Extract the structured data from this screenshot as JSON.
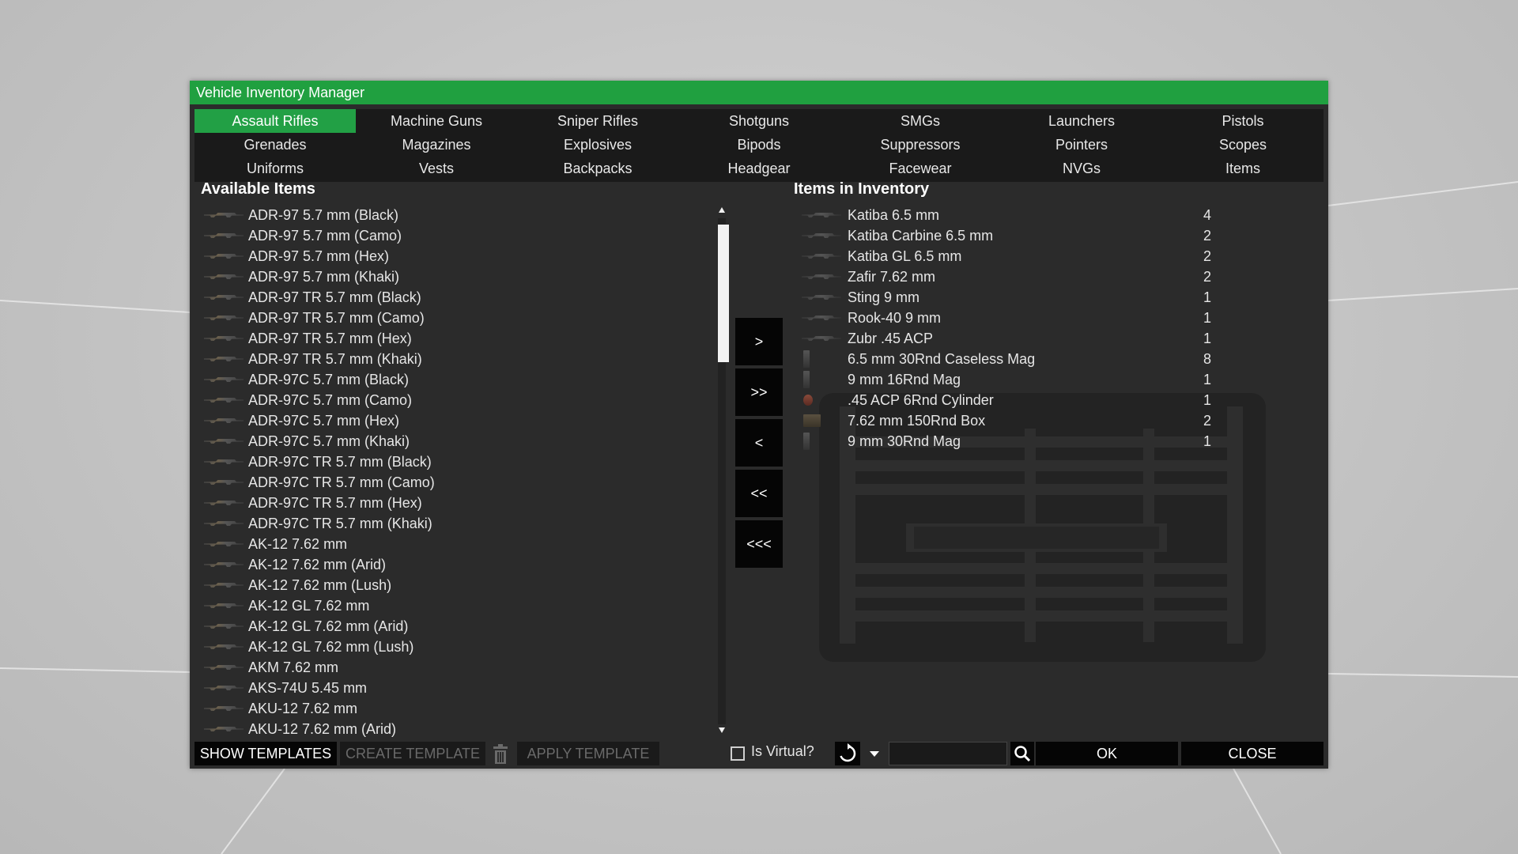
{
  "window": {
    "title": "Vehicle Inventory Manager"
  },
  "tabs": [
    {
      "label": "Assault Rifles",
      "active": true
    },
    {
      "label": "Machine Guns"
    },
    {
      "label": "Sniper Rifles"
    },
    {
      "label": "Shotguns"
    },
    {
      "label": "SMGs"
    },
    {
      "label": "Launchers"
    },
    {
      "label": "Pistols"
    },
    {
      "label": "Grenades"
    },
    {
      "label": "Magazines"
    },
    {
      "label": "Explosives"
    },
    {
      "label": "Bipods"
    },
    {
      "label": "Suppressors"
    },
    {
      "label": "Pointers"
    },
    {
      "label": "Scopes"
    },
    {
      "label": "Uniforms"
    },
    {
      "label": "Vests"
    },
    {
      "label": "Backpacks"
    },
    {
      "label": "Headgear"
    },
    {
      "label": "Facewear"
    },
    {
      "label": "NVGs"
    },
    {
      "label": "Items"
    }
  ],
  "available": {
    "title": "Available Items",
    "items": [
      {
        "label": "ADR-97 5.7 mm (Black)",
        "dlc": ""
      },
      {
        "label": "ADR-97 5.7 mm (Camo)",
        "dlc": ""
      },
      {
        "label": "ADR-97 5.7 mm (Hex)",
        "dlc": ""
      },
      {
        "label": "ADR-97 5.7 mm (Khaki)",
        "dlc": ""
      },
      {
        "label": "ADR-97 TR 5.7 mm (Black)",
        "dlc": ""
      },
      {
        "label": "ADR-97 TR 5.7 mm (Camo)",
        "dlc": ""
      },
      {
        "label": "ADR-97 TR 5.7 mm (Hex)",
        "dlc": ""
      },
      {
        "label": "ADR-97 TR 5.7 mm (Khaki)",
        "dlc": ""
      },
      {
        "label": "ADR-97C 5.7 mm (Black)",
        "dlc": ""
      },
      {
        "label": "ADR-97C 5.7 mm (Camo)",
        "dlc": ""
      },
      {
        "label": "ADR-97C 5.7 mm (Hex)",
        "dlc": ""
      },
      {
        "label": "ADR-97C 5.7 mm (Khaki)",
        "dlc": ""
      },
      {
        "label": "ADR-97C TR 5.7 mm (Black)",
        "dlc": ""
      },
      {
        "label": "ADR-97C TR 5.7 mm (Camo)",
        "dlc": ""
      },
      {
        "label": "ADR-97C TR 5.7 mm (Hex)",
        "dlc": ""
      },
      {
        "label": "ADR-97C TR 5.7 mm (Khaki)",
        "dlc": ""
      },
      {
        "label": "AK-12 7.62 mm",
        "dlc": "apex-icon"
      },
      {
        "label": "AK-12 7.62 mm (Arid)",
        "dlc": "contact-icon"
      },
      {
        "label": "AK-12 7.62 mm (Lush)",
        "dlc": "contact-icon"
      },
      {
        "label": "AK-12 GL 7.62 mm",
        "dlc": "apex-icon"
      },
      {
        "label": "AK-12 GL 7.62 mm (Arid)",
        "dlc": "contact-icon"
      },
      {
        "label": "AK-12 GL 7.62 mm (Lush)",
        "dlc": "contact-icon"
      },
      {
        "label": "AKM 7.62 mm",
        "dlc": "apex-icon"
      },
      {
        "label": "AKS-74U 5.45 mm",
        "dlc": "apex-icon"
      },
      {
        "label": "AKU-12 7.62 mm",
        "dlc": "contact-icon"
      },
      {
        "label": "AKU-12 7.62 mm (Arid)",
        "dlc": "contact-icon"
      }
    ]
  },
  "transfer": {
    "add_one": ">",
    "add_all": ">>",
    "remove_one": "<",
    "remove_all": "<<",
    "clear": "<<<"
  },
  "inventory": {
    "title": "Items in Inventory",
    "items": [
      {
        "label": "Katiba 6.5 mm",
        "count": "4",
        "icon": "rifle-icon"
      },
      {
        "label": "Katiba Carbine 6.5 mm",
        "count": "2",
        "icon": "rifle-icon"
      },
      {
        "label": "Katiba GL 6.5 mm",
        "count": "2",
        "icon": "rifle-icon"
      },
      {
        "label": "Zafir 7.62 mm",
        "count": "2",
        "icon": "rifle-icon"
      },
      {
        "label": "Sting 9 mm",
        "count": "1",
        "icon": "smg-icon"
      },
      {
        "label": "Rook-40 9 mm",
        "count": "1",
        "icon": "pistol-icon"
      },
      {
        "label": "Zubr .45 ACP",
        "count": "1",
        "icon": "pistol-icon"
      },
      {
        "label": "6.5 mm 30Rnd Caseless Mag",
        "count": "8",
        "icon": "magazine-icon"
      },
      {
        "label": "9 mm 16Rnd Mag",
        "count": "1",
        "icon": "magazine-icon"
      },
      {
        "label": ".45 ACP 6Rnd Cylinder",
        "count": "1",
        "icon": "cylinder-icon"
      },
      {
        "label": "7.62 mm 150Rnd Box",
        "count": "2",
        "icon": "ammo-box-icon"
      },
      {
        "label": "9 mm 30Rnd Mag",
        "count": "1",
        "icon": "magazine-icon"
      }
    ]
  },
  "bottom": {
    "show_templates": "SHOW TEMPLATES",
    "create_template": "CREATE TEMPLATE",
    "apply_template": "APPLY TEMPLATE",
    "is_virtual": "Is Virtual?",
    "search_placeholder": "",
    "ok": "OK",
    "close": "CLOSE"
  },
  "colors": {
    "accent": "#22a045",
    "panel": "#2b2b2b",
    "tabbar": "#1a1a1a",
    "button": "#050505"
  }
}
